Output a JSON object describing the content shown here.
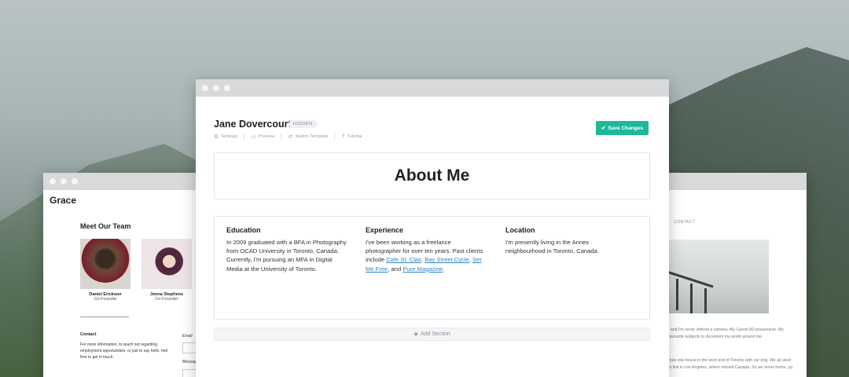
{
  "main": {
    "page_name": "Jane Dovercourt",
    "badge": "HIDDEN",
    "subnav": [
      {
        "label": "Settings",
        "icon": "gear-icon"
      },
      {
        "label": "Preview",
        "icon": "monitor-icon"
      },
      {
        "label": "Switch Template",
        "icon": "swap-icon"
      },
      {
        "label": "Tutorial",
        "icon": "help-icon"
      }
    ],
    "save_label": "Save Changes",
    "save_color": "#1fb99a",
    "about_title": "About Me",
    "columns": [
      {
        "heading": "Education",
        "body": "In 2009 graduated with a BFA in Photography from OCAD University in Toronto, Canada. Currently, I'm pursuing an MFA in Digital Media at the University of Toronto."
      },
      {
        "heading": "Experience",
        "intro": "I've been working as a freelance photographer for over ten years. Past clients include",
        "links": [
          "Cafe St. Clair",
          "Bay Street Cycle",
          "Set Me Free",
          "Pure Magazine"
        ],
        "and": "and"
      },
      {
        "heading": "Location",
        "body": "I'm presently living in the Annex neighbourhood in Toronto, Canada."
      }
    ],
    "add_section": "Add Section"
  },
  "left": {
    "brand": "Grace",
    "team_title": "Meet Our Team",
    "members": [
      {
        "name": "Daniel Erickson",
        "role": "Co-Founder"
      },
      {
        "name": "Jenna Stephens",
        "role": "Co-Founder"
      }
    ],
    "contact_title": "Contact",
    "contact_text": "For more information, to reach out regarding employment opportunities, or just to say hello, feel free to get in touch.",
    "email_label": "Email",
    "message_label": "Message"
  },
  "right": {
    "nav_contact": "CONTACT",
    "text1": ", and I'm never without a camera. My Canon 5D possession. My favourite subjects to document my world around me.",
    "text2": "rban row house in the west end of Toronto with our dog. We all used to live in Los Angeles, where missed Canada. So we drove home, up"
  }
}
